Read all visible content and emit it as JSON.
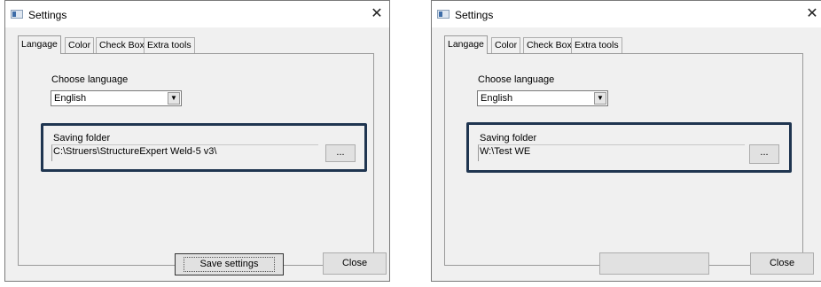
{
  "windows": [
    {
      "title": "Settings",
      "tabs": [
        "Langage",
        "Color",
        "Check Box",
        "Extra tools"
      ],
      "choose_language_label": "Choose language",
      "language_value": "English",
      "saving_folder_label": "Saving folder",
      "folder_path": "C:\\Struers\\StructureExpert Weld-5 v3\\",
      "browse_label": "...",
      "save_label": "Save settings",
      "close_label": "Close"
    },
    {
      "title": "Settings",
      "tabs": [
        "Langage",
        "Color",
        "Check Box",
        "Extra tools"
      ],
      "choose_language_label": "Choose language",
      "language_value": "English",
      "saving_folder_label": "Saving folder",
      "folder_path": "W:\\Test WE",
      "browse_label": "...",
      "save_label": "",
      "close_label": "Close"
    }
  ],
  "icons": {
    "close": "close-x",
    "app": "settings-window-icon",
    "dropdown": "chevron-down"
  },
  "colors": {
    "highlight_border": "#1f3550"
  }
}
